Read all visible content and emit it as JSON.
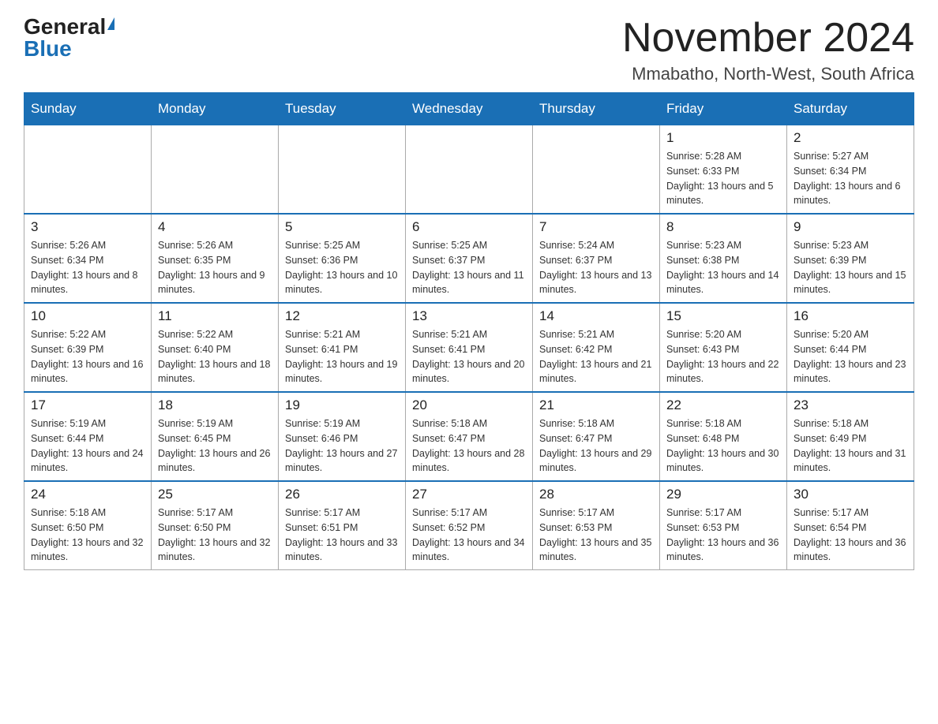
{
  "header": {
    "logo_general": "General",
    "logo_blue": "Blue",
    "month_title": "November 2024",
    "location": "Mmabatho, North-West, South Africa"
  },
  "weekdays": [
    "Sunday",
    "Monday",
    "Tuesday",
    "Wednesday",
    "Thursday",
    "Friday",
    "Saturday"
  ],
  "weeks": [
    [
      {
        "day": "",
        "info": ""
      },
      {
        "day": "",
        "info": ""
      },
      {
        "day": "",
        "info": ""
      },
      {
        "day": "",
        "info": ""
      },
      {
        "day": "",
        "info": ""
      },
      {
        "day": "1",
        "info": "Sunrise: 5:28 AM\nSunset: 6:33 PM\nDaylight: 13 hours and 5 minutes."
      },
      {
        "day": "2",
        "info": "Sunrise: 5:27 AM\nSunset: 6:34 PM\nDaylight: 13 hours and 6 minutes."
      }
    ],
    [
      {
        "day": "3",
        "info": "Sunrise: 5:26 AM\nSunset: 6:34 PM\nDaylight: 13 hours and 8 minutes."
      },
      {
        "day": "4",
        "info": "Sunrise: 5:26 AM\nSunset: 6:35 PM\nDaylight: 13 hours and 9 minutes."
      },
      {
        "day": "5",
        "info": "Sunrise: 5:25 AM\nSunset: 6:36 PM\nDaylight: 13 hours and 10 minutes."
      },
      {
        "day": "6",
        "info": "Sunrise: 5:25 AM\nSunset: 6:37 PM\nDaylight: 13 hours and 11 minutes."
      },
      {
        "day": "7",
        "info": "Sunrise: 5:24 AM\nSunset: 6:37 PM\nDaylight: 13 hours and 13 minutes."
      },
      {
        "day": "8",
        "info": "Sunrise: 5:23 AM\nSunset: 6:38 PM\nDaylight: 13 hours and 14 minutes."
      },
      {
        "day": "9",
        "info": "Sunrise: 5:23 AM\nSunset: 6:39 PM\nDaylight: 13 hours and 15 minutes."
      }
    ],
    [
      {
        "day": "10",
        "info": "Sunrise: 5:22 AM\nSunset: 6:39 PM\nDaylight: 13 hours and 16 minutes."
      },
      {
        "day": "11",
        "info": "Sunrise: 5:22 AM\nSunset: 6:40 PM\nDaylight: 13 hours and 18 minutes."
      },
      {
        "day": "12",
        "info": "Sunrise: 5:21 AM\nSunset: 6:41 PM\nDaylight: 13 hours and 19 minutes."
      },
      {
        "day": "13",
        "info": "Sunrise: 5:21 AM\nSunset: 6:41 PM\nDaylight: 13 hours and 20 minutes."
      },
      {
        "day": "14",
        "info": "Sunrise: 5:21 AM\nSunset: 6:42 PM\nDaylight: 13 hours and 21 minutes."
      },
      {
        "day": "15",
        "info": "Sunrise: 5:20 AM\nSunset: 6:43 PM\nDaylight: 13 hours and 22 minutes."
      },
      {
        "day": "16",
        "info": "Sunrise: 5:20 AM\nSunset: 6:44 PM\nDaylight: 13 hours and 23 minutes."
      }
    ],
    [
      {
        "day": "17",
        "info": "Sunrise: 5:19 AM\nSunset: 6:44 PM\nDaylight: 13 hours and 24 minutes."
      },
      {
        "day": "18",
        "info": "Sunrise: 5:19 AM\nSunset: 6:45 PM\nDaylight: 13 hours and 26 minutes."
      },
      {
        "day": "19",
        "info": "Sunrise: 5:19 AM\nSunset: 6:46 PM\nDaylight: 13 hours and 27 minutes."
      },
      {
        "day": "20",
        "info": "Sunrise: 5:18 AM\nSunset: 6:47 PM\nDaylight: 13 hours and 28 minutes."
      },
      {
        "day": "21",
        "info": "Sunrise: 5:18 AM\nSunset: 6:47 PM\nDaylight: 13 hours and 29 minutes."
      },
      {
        "day": "22",
        "info": "Sunrise: 5:18 AM\nSunset: 6:48 PM\nDaylight: 13 hours and 30 minutes."
      },
      {
        "day": "23",
        "info": "Sunrise: 5:18 AM\nSunset: 6:49 PM\nDaylight: 13 hours and 31 minutes."
      }
    ],
    [
      {
        "day": "24",
        "info": "Sunrise: 5:18 AM\nSunset: 6:50 PM\nDaylight: 13 hours and 32 minutes."
      },
      {
        "day": "25",
        "info": "Sunrise: 5:17 AM\nSunset: 6:50 PM\nDaylight: 13 hours and 32 minutes."
      },
      {
        "day": "26",
        "info": "Sunrise: 5:17 AM\nSunset: 6:51 PM\nDaylight: 13 hours and 33 minutes."
      },
      {
        "day": "27",
        "info": "Sunrise: 5:17 AM\nSunset: 6:52 PM\nDaylight: 13 hours and 34 minutes."
      },
      {
        "day": "28",
        "info": "Sunrise: 5:17 AM\nSunset: 6:53 PM\nDaylight: 13 hours and 35 minutes."
      },
      {
        "day": "29",
        "info": "Sunrise: 5:17 AM\nSunset: 6:53 PM\nDaylight: 13 hours and 36 minutes."
      },
      {
        "day": "30",
        "info": "Sunrise: 5:17 AM\nSunset: 6:54 PM\nDaylight: 13 hours and 36 minutes."
      }
    ]
  ]
}
